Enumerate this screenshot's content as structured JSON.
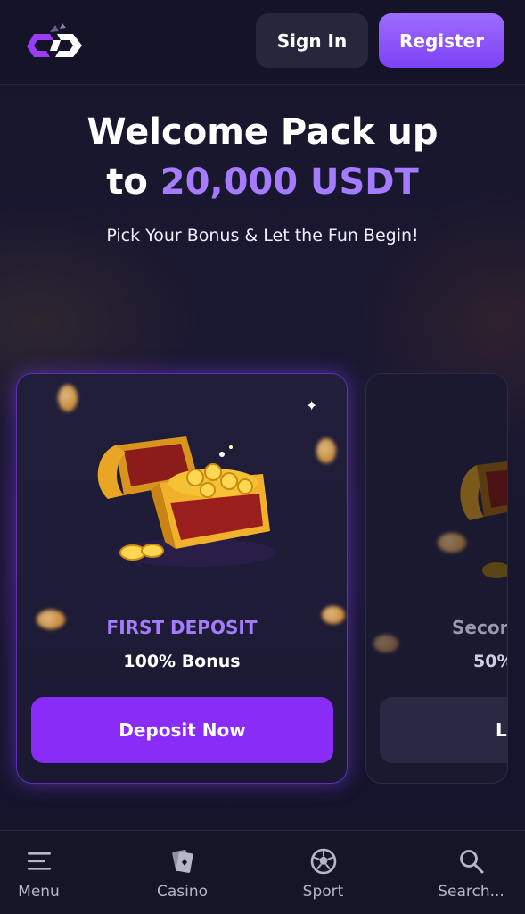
{
  "header": {
    "sign_in_label": "Sign In",
    "register_label": "Register"
  },
  "hero": {
    "title_line1": "Welcome Pack up",
    "title_line2_prefix": "to ",
    "title_line2_accent": "20,000 USDT",
    "subtitle": "Pick Your Bonus & Let the Fun Begin!"
  },
  "cards": [
    {
      "label": "FIRST DEPOSIT",
      "bonus": "100% Bonus",
      "button_label": "Deposit Now",
      "icon": "treasure-chest-icon"
    },
    {
      "label": "Secor",
      "bonus": "50%",
      "button_label": "L",
      "icon": "treasure-chest-icon"
    }
  ],
  "bottom_nav": [
    {
      "label": "Menu",
      "icon": "menu-icon"
    },
    {
      "label": "Casino",
      "icon": "casino-cards-icon"
    },
    {
      "label": "Sport",
      "icon": "soccer-ball-icon"
    },
    {
      "label": "Search...",
      "icon": "search-icon"
    }
  ],
  "colors": {
    "accent": "#a57cff",
    "primary_button": "#8a2cf7",
    "register_button": "#8b55f8",
    "background": "#151429"
  }
}
